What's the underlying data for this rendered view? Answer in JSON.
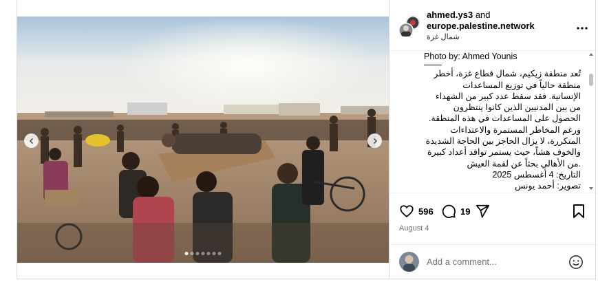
{
  "post": {
    "usernames": {
      "first": "ahmed.ys3",
      "joiner": "and",
      "second": "europe.palestine.network"
    },
    "location": "شمال غزة",
    "caption": {
      "photo_by": "Photo by: Ahmed Younis",
      "arabic_lines": [
        "تُعد منطقة زيكيم، شمال قطاع غزة، أخطر",
        "منطقة حالياً في توزيع المساعدات",
        "الإنسانية. فقد سقط عدد كبير من الشهداء",
        "من بين المدنيين الذين كانوا ينتظرون",
        "الحصول على المساعدات في هذه المنطقة.",
        "ورغم المخاطر المستمرة والاعتداءات",
        "المتكررة، لا يزال الحاجز بين الحاجة الشديدة",
        "والخوف هشاً، حيث يستمر توافد أعداد كبيرة",
        ".من الأهالي بحثاً عن لقمة العيش",
        "التاريخ: 4 أغسطس 2025",
        "تصوير: أحمد يونس"
      ]
    },
    "likes": "596",
    "comments": "19",
    "date": "August 4",
    "comment_placeholder": "Add a comment...",
    "carousel": {
      "total": 7,
      "active_index": 0
    }
  },
  "icons": {
    "prev": "chevron-left-icon",
    "next": "chevron-right-icon",
    "more": "more-options-icon",
    "like": "heart-icon",
    "comment": "comment-bubble-icon",
    "share": "send-icon",
    "save": "bookmark-icon",
    "emoji": "smiley-icon"
  }
}
